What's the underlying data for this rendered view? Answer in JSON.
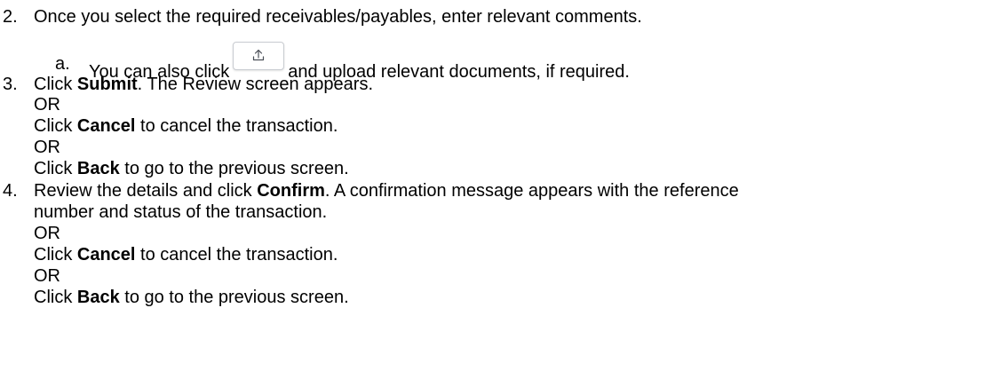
{
  "steps": {
    "s2": {
      "number": "2.",
      "text": "Once you select the required receivables/payables, enter relevant comments.",
      "sub": {
        "letter": "a.",
        "before": "You can also click",
        "after": "and upload relevant documents, if required."
      }
    },
    "s3": {
      "number": "3.",
      "l1_pre": "Click ",
      "l1_bold": "Submit",
      "l1_post": ". The Review screen appears.",
      "or1": "OR",
      "l2_pre": "Click ",
      "l2_bold": "Cancel",
      "l2_post": " to cancel the transaction.",
      "or2": "OR",
      "l3_pre": "Click ",
      "l3_bold": "Back",
      "l3_post": " to go to the previous screen."
    },
    "s4": {
      "number": "4.",
      "l1_pre": "Review the details and click ",
      "l1_bold": "Confirm",
      "l1_post": ". A confirmation message appears with the reference",
      "l1b": "number and status of the transaction.",
      "or1": "OR",
      "l2_pre": "Click ",
      "l2_bold": "Cancel",
      "l2_post": " to cancel the transaction.",
      "or2": "OR",
      "l3_pre": "Click ",
      "l3_bold": "Back",
      "l3_post": " to go to the previous screen."
    }
  },
  "icons": {
    "upload": "upload-icon"
  }
}
